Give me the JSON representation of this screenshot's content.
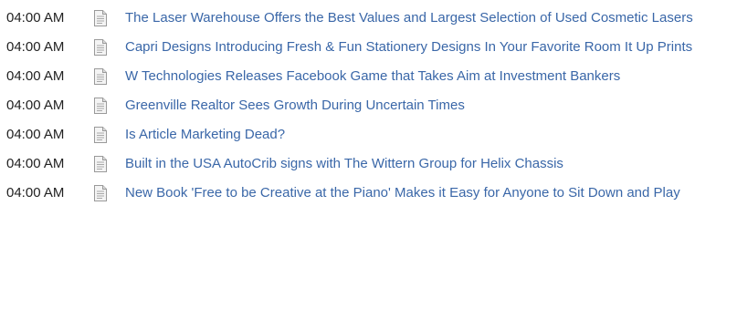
{
  "news": {
    "items": [
      {
        "time": "04:00 AM",
        "icon": "document-icon",
        "title": "The Laser Warehouse Offers the Best Values and Largest Selection of Used Cosmetic Lasers"
      },
      {
        "time": "04:00 AM",
        "icon": "document-icon",
        "title": "Capri Designs Introducing Fresh & Fun Stationery Designs In Your Favorite Room It Up Prints"
      },
      {
        "time": "04:00 AM",
        "icon": "document-icon",
        "title": "W Technologies Releases Facebook Game that Takes Aim at Investment Bankers"
      },
      {
        "time": "04:00 AM",
        "icon": "document-icon",
        "title": "Greenville Realtor Sees Growth During Uncertain Times"
      },
      {
        "time": "04:00 AM",
        "icon": "document-icon",
        "title": "Is Article Marketing Dead?"
      },
      {
        "time": "04:00 AM",
        "icon": "document-icon",
        "title": "Built in the USA AutoCrib signs with The Wittern Group for Helix Chassis"
      },
      {
        "time": "04:00 AM",
        "icon": "document-icon",
        "title": "New Book 'Free to be Creative at the Piano' Makes it Easy for Anyone to Sit Down and Play"
      }
    ]
  },
  "colors": {
    "link": "#3a67a8",
    "time_text": "#222222",
    "background": "#ffffff"
  }
}
